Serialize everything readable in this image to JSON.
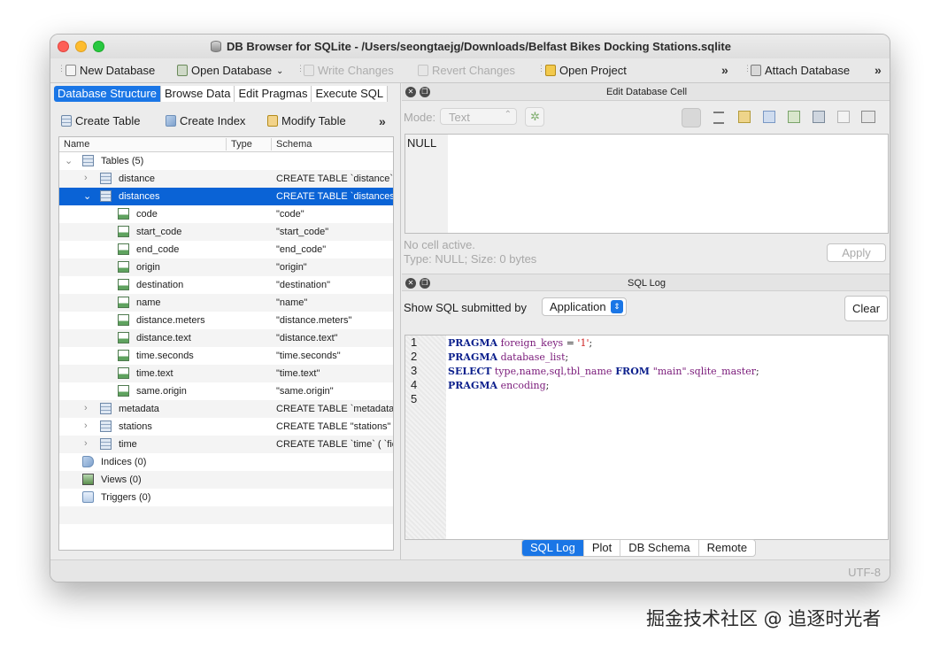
{
  "window": {
    "title": "DB Browser for SQLite - /Users/seongtaejg/Downloads/Belfast Bikes Docking Stations.sqlite"
  },
  "toolbar": {
    "new_database": "New Database",
    "open_database": "Open Database",
    "write_changes": "Write Changes",
    "revert_changes": "Revert Changes",
    "open_project": "Open Project",
    "attach_database": "Attach Database"
  },
  "tabs": [
    "Database Structure",
    "Browse Data",
    "Edit Pragmas",
    "Execute SQL"
  ],
  "structure_toolbar": {
    "create_table": "Create Table",
    "create_index": "Create Index",
    "modify_table": "Modify Table"
  },
  "tree": {
    "headers": {
      "name": "Name",
      "type": "Type",
      "schema": "Schema"
    },
    "tables_label": "Tables (5)",
    "tables": [
      {
        "name": "distance",
        "schema": "CREATE TABLE `distance` ("
      },
      {
        "name": "distances",
        "schema": "CREATE TABLE `distances`"
      }
    ],
    "fields": [
      {
        "name": "code",
        "schema": "\"code\""
      },
      {
        "name": "start_code",
        "schema": "\"start_code\""
      },
      {
        "name": "end_code",
        "schema": "\"end_code\""
      },
      {
        "name": "origin",
        "schema": "\"origin\""
      },
      {
        "name": "destination",
        "schema": "\"destination\""
      },
      {
        "name": "name",
        "schema": "\"name\""
      },
      {
        "name": "distance.meters",
        "schema": "\"distance.meters\""
      },
      {
        "name": "distance.text",
        "schema": "\"distance.text\""
      },
      {
        "name": "time.seconds",
        "schema": "\"time.seconds\""
      },
      {
        "name": "time.text",
        "schema": "\"time.text\""
      },
      {
        "name": "same.origin",
        "schema": "\"same.origin\""
      }
    ],
    "tables_more": [
      {
        "name": "metadata",
        "schema": "CREATE TABLE `metadata` "
      },
      {
        "name": "stations",
        "schema": "CREATE TABLE \"stations\" ("
      },
      {
        "name": "time",
        "schema": "CREATE TABLE `time` ( `fie"
      }
    ],
    "indices_label": "Indices (0)",
    "views_label": "Views (0)",
    "triggers_label": "Triggers (0)"
  },
  "edit_cell": {
    "title": "Edit Database Cell",
    "mode_label": "Mode:",
    "mode_value": "Text",
    "value": "NULL",
    "status": "No cell active.",
    "type_info": "Type: NULL; Size: 0 bytes",
    "apply": "Apply"
  },
  "sql_log": {
    "title": "SQL Log",
    "show_label": "Show SQL submitted by",
    "submitted_by": "Application",
    "clear": "Clear",
    "line_numbers": [
      "1",
      "2",
      "3",
      "4",
      "5"
    ],
    "lines": [
      [
        "PRAGMA",
        "foreign_keys",
        " = ",
        "'1'",
        ";"
      ],
      [
        "PRAGMA",
        "database_list",
        "",
        "",
        ";"
      ],
      [
        "SELECT",
        "type,name,sql,tbl_name",
        " FROM ",
        "\"main\".sqlite_master",
        ";"
      ],
      [
        "PRAGMA",
        "encoding",
        "",
        "",
        ";"
      ]
    ]
  },
  "bottom_tabs": [
    "SQL Log",
    "Plot",
    "DB Schema",
    "Remote"
  ],
  "statusbar": {
    "encoding": "UTF-8"
  },
  "watermark": "掘金技术社区 @ 追逐时光者"
}
